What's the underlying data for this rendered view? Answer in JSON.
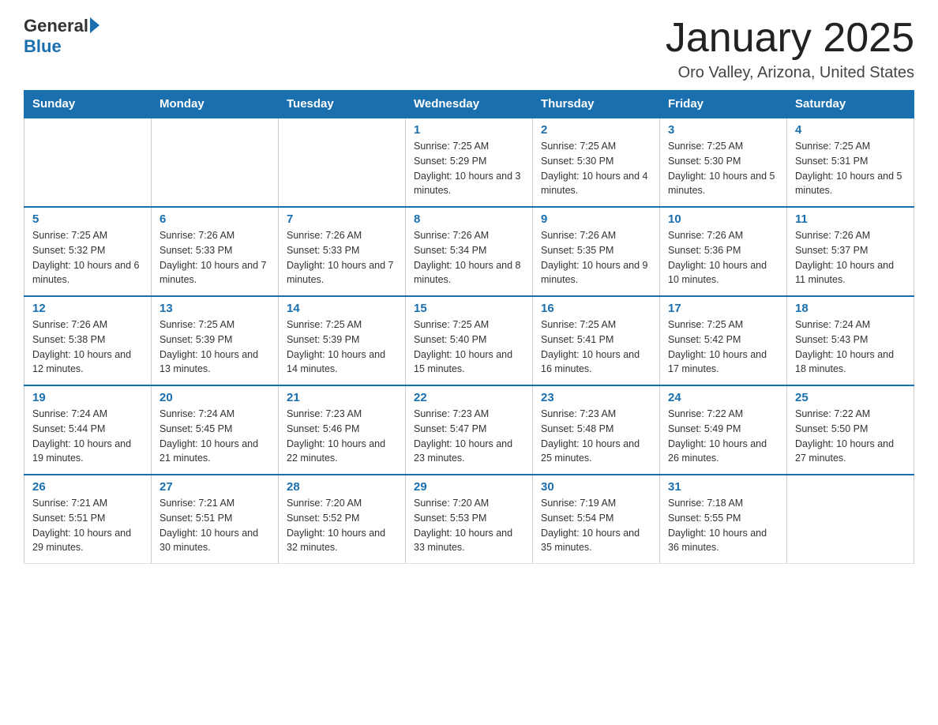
{
  "header": {
    "logo_general": "General",
    "logo_blue": "Blue",
    "title": "January 2025",
    "subtitle": "Oro Valley, Arizona, United States"
  },
  "days_of_week": [
    "Sunday",
    "Monday",
    "Tuesday",
    "Wednesday",
    "Thursday",
    "Friday",
    "Saturday"
  ],
  "weeks": [
    [
      {
        "day": "",
        "info": ""
      },
      {
        "day": "",
        "info": ""
      },
      {
        "day": "",
        "info": ""
      },
      {
        "day": "1",
        "info": "Sunrise: 7:25 AM\nSunset: 5:29 PM\nDaylight: 10 hours and 3 minutes."
      },
      {
        "day": "2",
        "info": "Sunrise: 7:25 AM\nSunset: 5:30 PM\nDaylight: 10 hours and 4 minutes."
      },
      {
        "day": "3",
        "info": "Sunrise: 7:25 AM\nSunset: 5:30 PM\nDaylight: 10 hours and 5 minutes."
      },
      {
        "day": "4",
        "info": "Sunrise: 7:25 AM\nSunset: 5:31 PM\nDaylight: 10 hours and 5 minutes."
      }
    ],
    [
      {
        "day": "5",
        "info": "Sunrise: 7:25 AM\nSunset: 5:32 PM\nDaylight: 10 hours and 6 minutes."
      },
      {
        "day": "6",
        "info": "Sunrise: 7:26 AM\nSunset: 5:33 PM\nDaylight: 10 hours and 7 minutes."
      },
      {
        "day": "7",
        "info": "Sunrise: 7:26 AM\nSunset: 5:33 PM\nDaylight: 10 hours and 7 minutes."
      },
      {
        "day": "8",
        "info": "Sunrise: 7:26 AM\nSunset: 5:34 PM\nDaylight: 10 hours and 8 minutes."
      },
      {
        "day": "9",
        "info": "Sunrise: 7:26 AM\nSunset: 5:35 PM\nDaylight: 10 hours and 9 minutes."
      },
      {
        "day": "10",
        "info": "Sunrise: 7:26 AM\nSunset: 5:36 PM\nDaylight: 10 hours and 10 minutes."
      },
      {
        "day": "11",
        "info": "Sunrise: 7:26 AM\nSunset: 5:37 PM\nDaylight: 10 hours and 11 minutes."
      }
    ],
    [
      {
        "day": "12",
        "info": "Sunrise: 7:26 AM\nSunset: 5:38 PM\nDaylight: 10 hours and 12 minutes."
      },
      {
        "day": "13",
        "info": "Sunrise: 7:25 AM\nSunset: 5:39 PM\nDaylight: 10 hours and 13 minutes."
      },
      {
        "day": "14",
        "info": "Sunrise: 7:25 AM\nSunset: 5:39 PM\nDaylight: 10 hours and 14 minutes."
      },
      {
        "day": "15",
        "info": "Sunrise: 7:25 AM\nSunset: 5:40 PM\nDaylight: 10 hours and 15 minutes."
      },
      {
        "day": "16",
        "info": "Sunrise: 7:25 AM\nSunset: 5:41 PM\nDaylight: 10 hours and 16 minutes."
      },
      {
        "day": "17",
        "info": "Sunrise: 7:25 AM\nSunset: 5:42 PM\nDaylight: 10 hours and 17 minutes."
      },
      {
        "day": "18",
        "info": "Sunrise: 7:24 AM\nSunset: 5:43 PM\nDaylight: 10 hours and 18 minutes."
      }
    ],
    [
      {
        "day": "19",
        "info": "Sunrise: 7:24 AM\nSunset: 5:44 PM\nDaylight: 10 hours and 19 minutes."
      },
      {
        "day": "20",
        "info": "Sunrise: 7:24 AM\nSunset: 5:45 PM\nDaylight: 10 hours and 21 minutes."
      },
      {
        "day": "21",
        "info": "Sunrise: 7:23 AM\nSunset: 5:46 PM\nDaylight: 10 hours and 22 minutes."
      },
      {
        "day": "22",
        "info": "Sunrise: 7:23 AM\nSunset: 5:47 PM\nDaylight: 10 hours and 23 minutes."
      },
      {
        "day": "23",
        "info": "Sunrise: 7:23 AM\nSunset: 5:48 PM\nDaylight: 10 hours and 25 minutes."
      },
      {
        "day": "24",
        "info": "Sunrise: 7:22 AM\nSunset: 5:49 PM\nDaylight: 10 hours and 26 minutes."
      },
      {
        "day": "25",
        "info": "Sunrise: 7:22 AM\nSunset: 5:50 PM\nDaylight: 10 hours and 27 minutes."
      }
    ],
    [
      {
        "day": "26",
        "info": "Sunrise: 7:21 AM\nSunset: 5:51 PM\nDaylight: 10 hours and 29 minutes."
      },
      {
        "day": "27",
        "info": "Sunrise: 7:21 AM\nSunset: 5:51 PM\nDaylight: 10 hours and 30 minutes."
      },
      {
        "day": "28",
        "info": "Sunrise: 7:20 AM\nSunset: 5:52 PM\nDaylight: 10 hours and 32 minutes."
      },
      {
        "day": "29",
        "info": "Sunrise: 7:20 AM\nSunset: 5:53 PM\nDaylight: 10 hours and 33 minutes."
      },
      {
        "day": "30",
        "info": "Sunrise: 7:19 AM\nSunset: 5:54 PM\nDaylight: 10 hours and 35 minutes."
      },
      {
        "day": "31",
        "info": "Sunrise: 7:18 AM\nSunset: 5:55 PM\nDaylight: 10 hours and 36 minutes."
      },
      {
        "day": "",
        "info": ""
      }
    ]
  ]
}
